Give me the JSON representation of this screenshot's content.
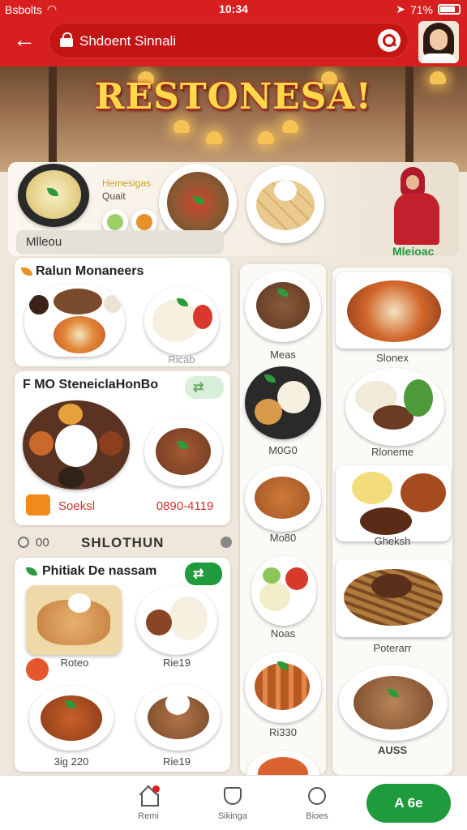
{
  "status_bar": {
    "carrier": "Bsbolts",
    "time": "10:34",
    "battery": "71%"
  },
  "header": {
    "search_query": "Shdoent Sinnali"
  },
  "hero": {
    "title": "RESTONESA!"
  },
  "featured": {
    "line1": "Hemesigas",
    "line2": "Quait"
  },
  "menu_tab": {
    "label": "Mlleou"
  },
  "right_header": {
    "label": "Mleioac"
  },
  "card1": {
    "title": "Ralun Monaneers",
    "caption": "Ricab"
  },
  "card2": {
    "title": "F MO SteneiclaHonBo",
    "left_caption": "Soeksl",
    "right_caption": "0890-4119"
  },
  "section": {
    "number": "00",
    "title": "SHLOTHUN"
  },
  "card3": {
    "title": "Phitiak De nassam",
    "captions": [
      "Roteo",
      "Rie19",
      "3ig 220",
      "Rie19"
    ]
  },
  "middle_column": {
    "captions": [
      "Meas",
      "M0G0",
      "Mo80",
      "Noas",
      "Ri330"
    ]
  },
  "right_column": {
    "captions": [
      "Slonex",
      "Rloneme",
      "Gheksh",
      "Poterarr",
      "AUSS"
    ]
  },
  "bottom_nav": {
    "items": [
      "Remi",
      "Sikinga",
      "Bioes"
    ],
    "cta": "A 6e"
  },
  "colors": {
    "brand_red": "#d81f1f",
    "accent_green": "#1f9a3c",
    "title_gold": "#ffd94a"
  },
  "icons": [
    "back-arrow-icon",
    "lock-icon",
    "search-icon",
    "home-icon",
    "shield-icon",
    "heart-icon"
  ]
}
